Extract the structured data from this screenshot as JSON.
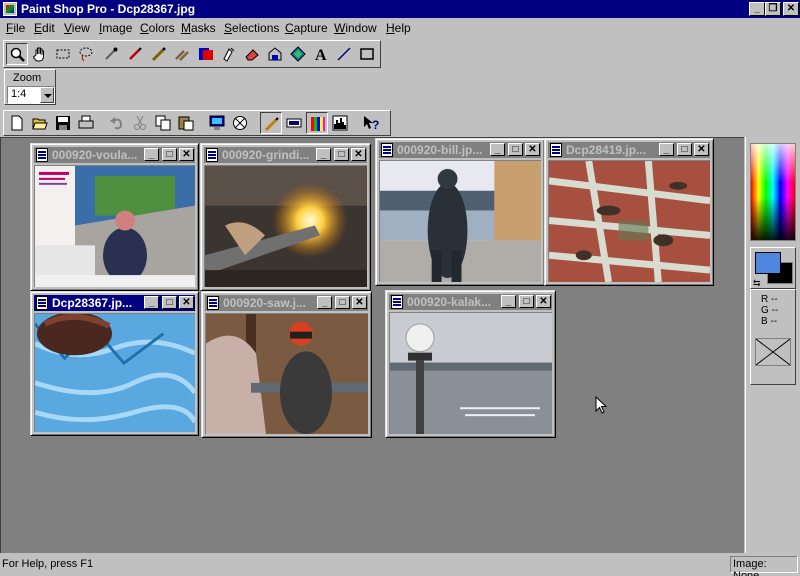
{
  "window": {
    "title": "Paint Shop Pro - Dcp28367.jpg"
  },
  "menu": [
    "File",
    "Edit",
    "View",
    "Image",
    "Colors",
    "Masks",
    "Selections",
    "Capture",
    "Window",
    "Help"
  ],
  "tools_icons": [
    "zoom-icon",
    "pan-icon",
    "rect-select-icon",
    "lasso-icon",
    "eyedropper-icon",
    "paintbrush-icon",
    "airbrush-icon",
    "clone-icon",
    "color-replace-icon",
    "retouch-icon",
    "eraser-icon",
    "flood-fill-icon",
    "picture-tube-icon",
    "text-icon",
    "line-icon",
    "shape-icon"
  ],
  "zoom": {
    "label": "Zoom",
    "value": "1:4"
  },
  "standard_icons": [
    "new-icon",
    "open-icon",
    "save-icon",
    "print-icon",
    "undo-icon",
    "cut-icon",
    "copy-icon",
    "paste-icon",
    "full-screen-icon",
    "browse-icon",
    "tool-palette-icon",
    "style-bar-icon",
    "color-palette-icon",
    "histogram-icon",
    "context-help-icon"
  ],
  "documents": [
    {
      "name": "000920-voula...",
      "active": false
    },
    {
      "name": "000920-grindi...",
      "active": false
    },
    {
      "name": "000920-bill.jp...",
      "active": false
    },
    {
      "name": "Dcp28419.jp...",
      "active": false
    },
    {
      "name": "Dcp28367.jp...",
      "active": true
    },
    {
      "name": "000920-saw.j...",
      "active": false
    },
    {
      "name": "000920-kalak...",
      "active": false
    }
  ],
  "colors": {
    "foreground": "#4f86e0",
    "background": "#000000",
    "r": "R --",
    "g": "G --",
    "b": "B --"
  },
  "status": {
    "help": "For Help, press F1",
    "image": "Image: None"
  }
}
